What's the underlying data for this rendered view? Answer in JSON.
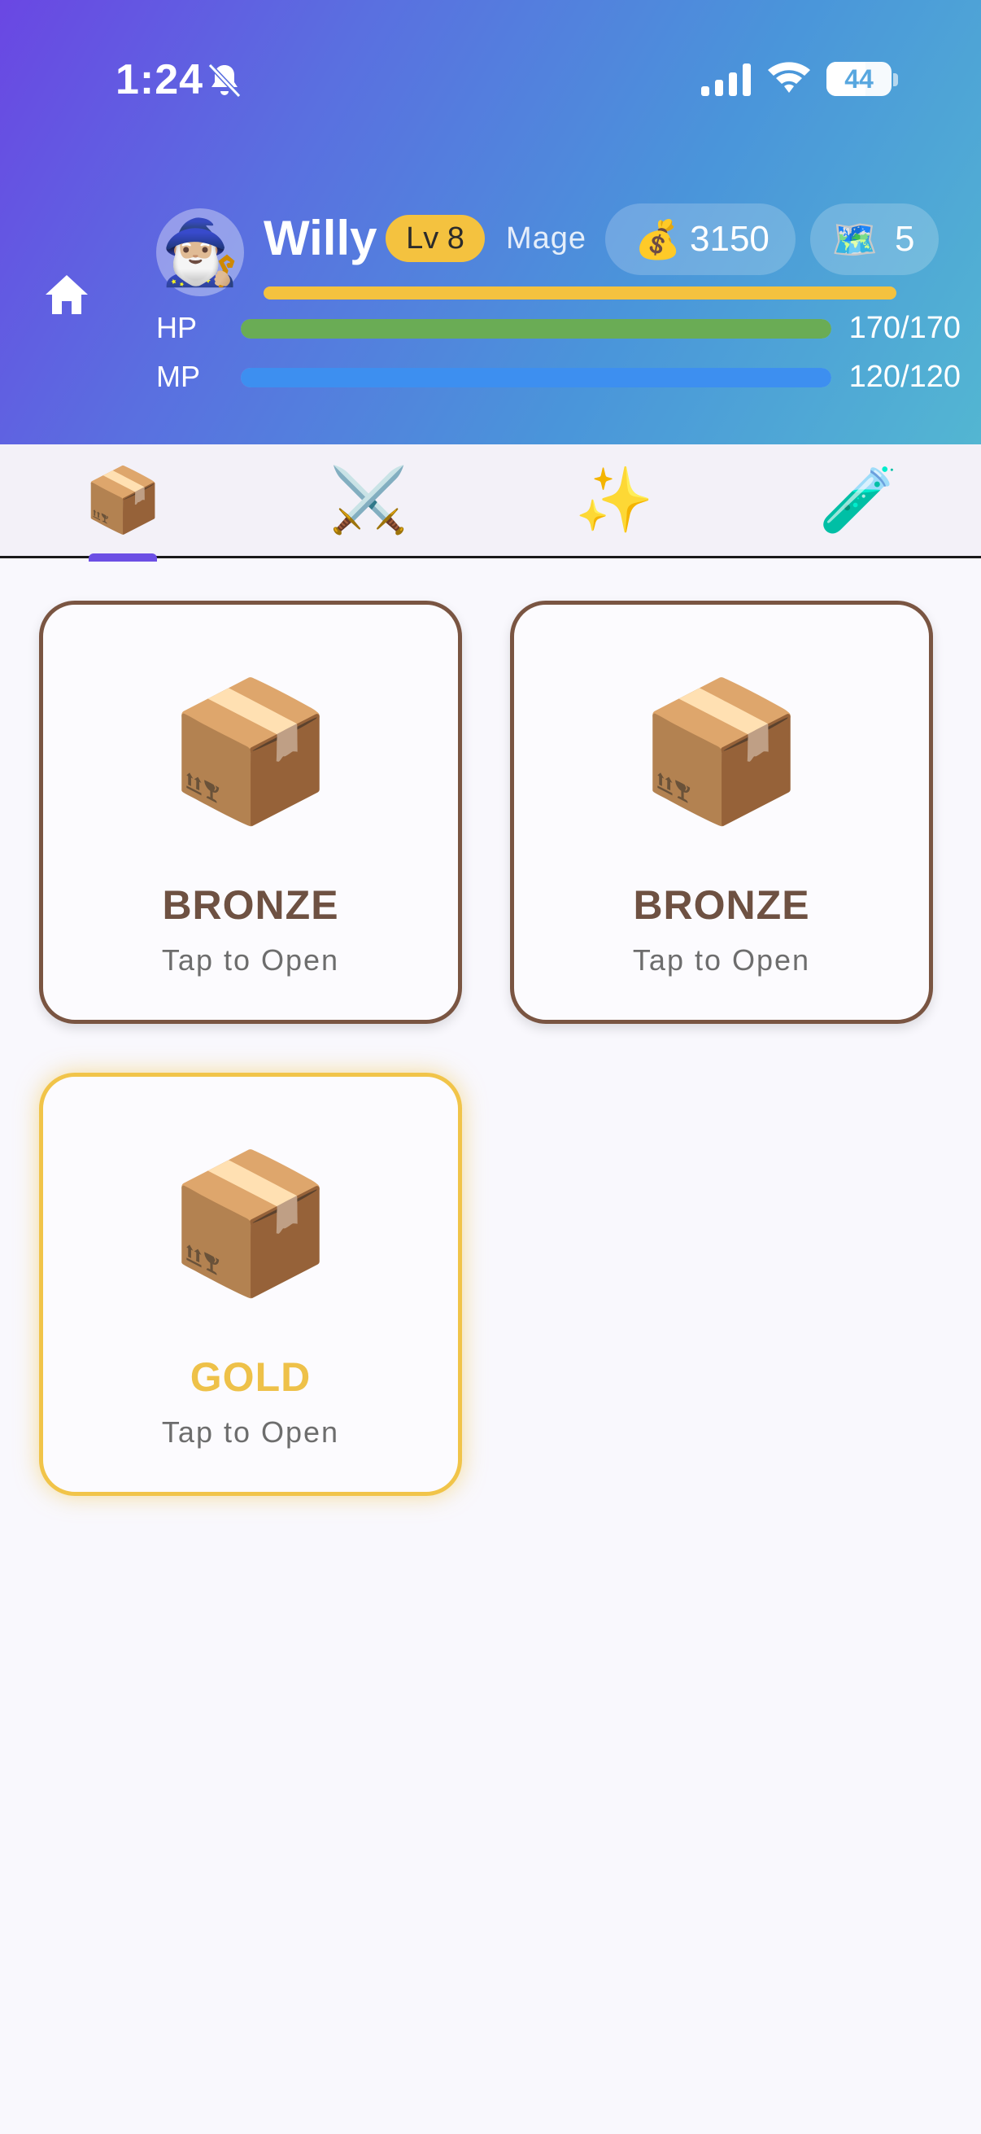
{
  "status_bar": {
    "time": "1:24",
    "battery": "44",
    "icons": [
      "bell-slash-icon",
      "signal-icon",
      "wifi-icon",
      "battery-icon"
    ]
  },
  "header": {
    "home_icon": "home-icon",
    "avatar_emoji": "🧙🏼‍♂️",
    "username": "Willy",
    "level": "Lv 8",
    "class": "Mage",
    "gold_icon": "💰",
    "gold": "3150",
    "map_icon": "🗺️",
    "maps": "5",
    "xp_progress": 1.0,
    "hp": {
      "label": "HP",
      "value": "170/170",
      "progress": 1.0,
      "color": "#6aac55"
    },
    "mp": {
      "label": "MP",
      "value": "120/120",
      "progress": 1.0,
      "color": "#3d8ff0"
    },
    "xp_color": "#f4c23f"
  },
  "tabs": [
    {
      "icon": "📦",
      "name": "chests",
      "active": true
    },
    {
      "icon": "⚔️",
      "name": "equipment",
      "active": false
    },
    {
      "icon": "✨",
      "name": "skills",
      "active": false
    },
    {
      "icon": "🧪",
      "name": "potions",
      "active": false
    }
  ],
  "chests": [
    {
      "icon": "📦",
      "tier": "BRONZE",
      "action": "Tap to Open",
      "color": "#7a5542"
    },
    {
      "icon": "📦",
      "tier": "BRONZE",
      "action": "Tap to Open",
      "color": "#7a5542"
    },
    {
      "icon": "📦",
      "tier": "GOLD",
      "action": "Tap to Open",
      "color": "#f1c449"
    }
  ]
}
